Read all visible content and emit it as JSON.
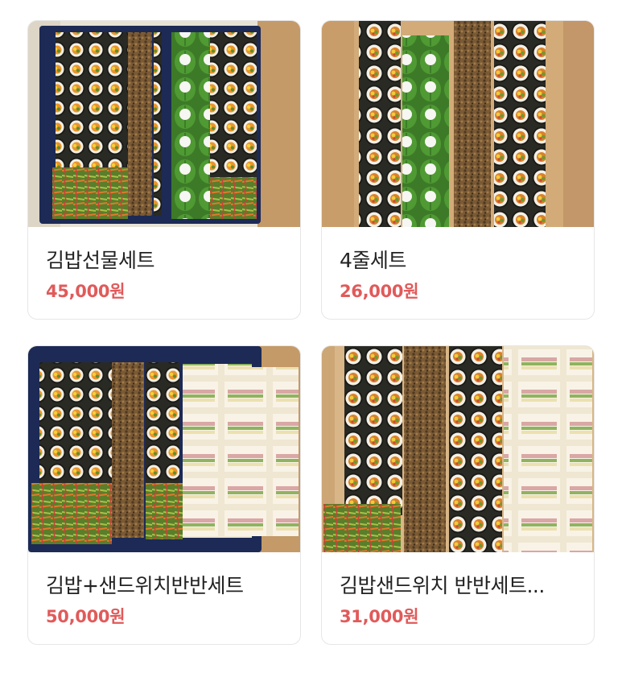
{
  "products": [
    {
      "title": "김밥선물세트",
      "price": "45,000원",
      "image_icon": "gimbap-gift-set-photo"
    },
    {
      "title": "4줄세트",
      "price": "26,000원",
      "image_icon": "four-roll-set-photo"
    },
    {
      "title": "김밥+샌드위치반반세트",
      "price": "50,000원",
      "image_icon": "gimbap-sandwich-half-set-photo"
    },
    {
      "title": "김밥샌드위치 반반세트...",
      "price": "31,000원",
      "image_icon": "gimbap-sandwich-half-set-photo"
    }
  ],
  "colors": {
    "price": "#e15a5a",
    "title": "#222222",
    "card_border": "#e6e6e6"
  }
}
